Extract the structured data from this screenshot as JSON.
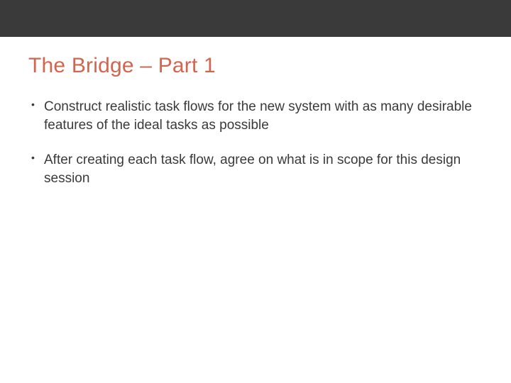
{
  "title": "The Bridge – Part 1",
  "bullets": [
    "Construct realistic task flows for the new system with as many desirable features of the ideal tasks as possible",
    " After creating each task flow, agree on what is in scope for this design session"
  ],
  "colors": {
    "accent": "#d1654f",
    "topbar": "#3a3a3a",
    "text": "#3a3a3a"
  }
}
